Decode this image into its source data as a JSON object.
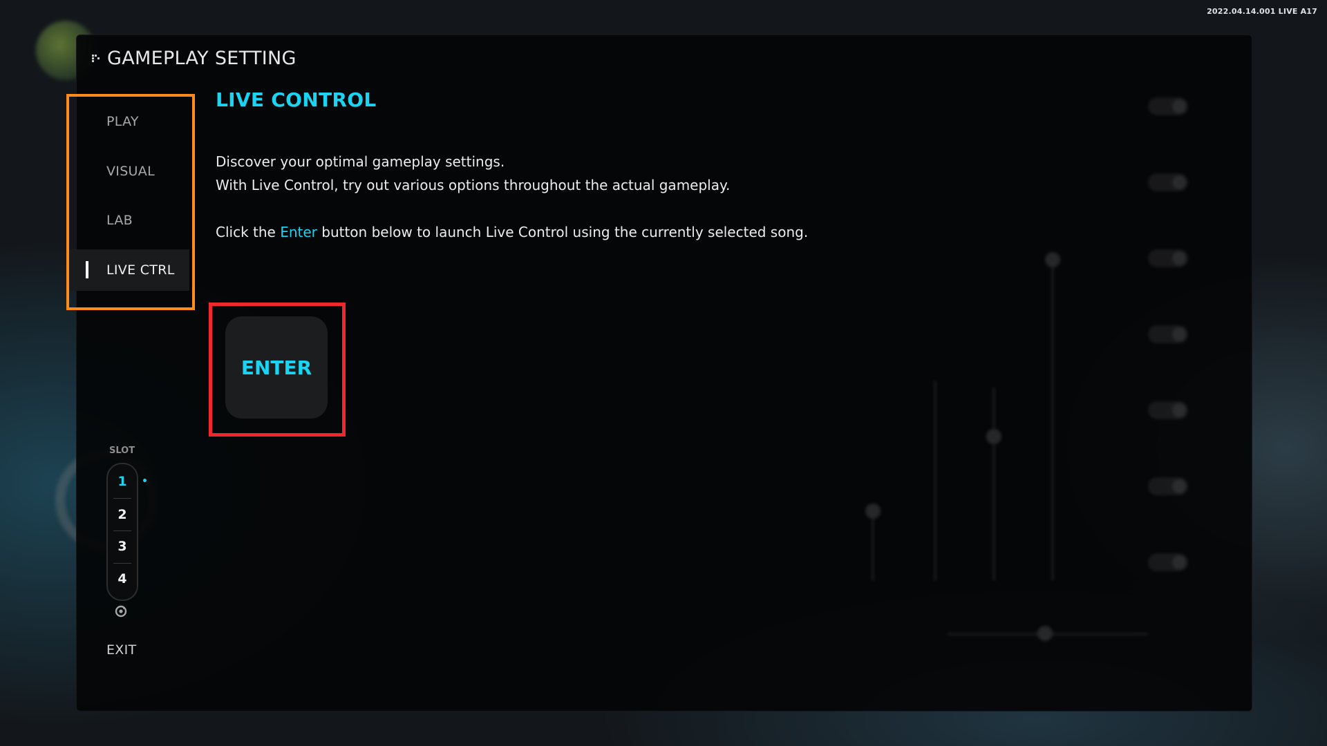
{
  "version": "2022.04.14.001 LIVE A17",
  "panel": {
    "title": "GAMEPLAY SETTING",
    "title_icon": "grip-icon"
  },
  "sidenav": {
    "items": [
      {
        "label": "PLAY",
        "active": false
      },
      {
        "label": "VISUAL",
        "active": false
      },
      {
        "label": "LAB",
        "active": false
      },
      {
        "label": "LIVE CTRL",
        "active": true
      }
    ],
    "highlight_color": "#ff8c1a"
  },
  "content": {
    "title": "LIVE CONTROL",
    "line1": "Discover your optimal gameplay settings.",
    "line2": "With Live Control, try out various options throughout the actual gameplay.",
    "line3_before": "Click the ",
    "line3_link": "Enter",
    "line3_after": " button below to launch Live Control using the currently selected song."
  },
  "enter_button": {
    "label": "ENTER",
    "highlight_color": "#f0282d"
  },
  "slots": {
    "label": "SLOT",
    "items": [
      "1",
      "2",
      "3",
      "4"
    ],
    "active": "1",
    "reset_icon": "refresh-icon"
  },
  "exit_label": "EXIT",
  "colors": {
    "accent": "#19d4f2",
    "panel_bg": "#040506"
  }
}
